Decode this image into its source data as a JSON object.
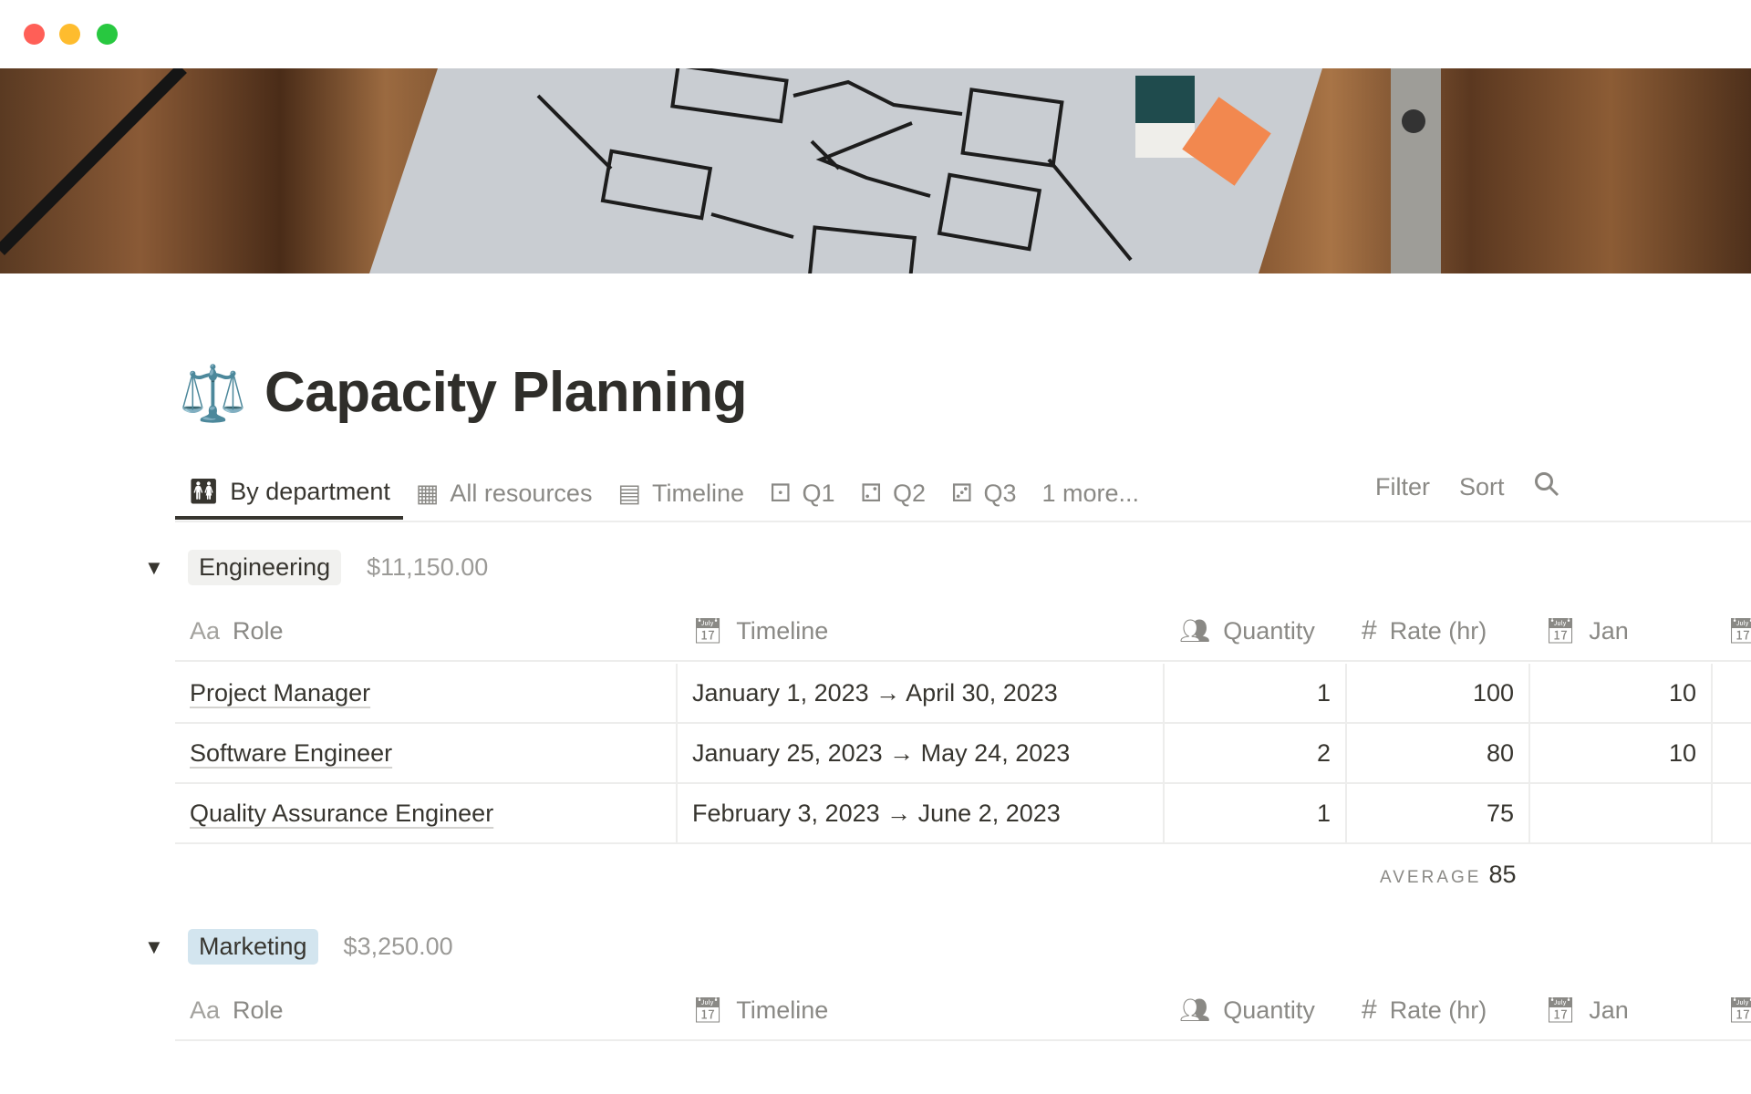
{
  "window": {
    "controls": {
      "close": "#ff5f57",
      "minimize": "#febc2e",
      "zoom": "#28c840"
    }
  },
  "page": {
    "icon": "balance-scale-icon",
    "title": "Capacity Planning"
  },
  "tabs": [
    {
      "label": "By department",
      "icon": "people-icon",
      "active": true
    },
    {
      "label": "All resources",
      "icon": "table-icon"
    },
    {
      "label": "Timeline",
      "icon": "timeline-icon"
    },
    {
      "label": "Q1",
      "icon": "dice-one-icon"
    },
    {
      "label": "Q2",
      "icon": "dice-two-icon"
    },
    {
      "label": "Q3",
      "icon": "dice-three-icon"
    },
    {
      "label": "1 more..."
    }
  ],
  "toolbar": {
    "filter": "Filter",
    "sort": "Sort",
    "search_icon": "search-icon"
  },
  "columns": {
    "role": "Role",
    "role_prefix": "Aa",
    "timeline": "Timeline",
    "quantity": "Quantity",
    "rate": "Rate (hr)",
    "jan": "Jan"
  },
  "groups": [
    {
      "name": "Engineering",
      "tag_color": "#f1f1ef",
      "total": "$11,150.00",
      "rows": [
        {
          "role": "Project Manager",
          "timeline": "January 1, 2023 → April 30, 2023",
          "quantity": "1",
          "rate": "100",
          "jan": "10"
        },
        {
          "role": "Software Engineer",
          "timeline": "January 25, 2023 → May 24, 2023",
          "quantity": "2",
          "rate": "80",
          "jan": "10"
        },
        {
          "role": "Quality Assurance Engineer",
          "timeline": "February 3, 2023 → June 2, 2023",
          "quantity": "1",
          "rate": "75",
          "jan": ""
        }
      ],
      "footer": {
        "label": "AVERAGE",
        "value": "85"
      }
    },
    {
      "name": "Marketing",
      "tag_color": "#d3e5ef",
      "total": "$3,250.00",
      "rows": []
    }
  ]
}
